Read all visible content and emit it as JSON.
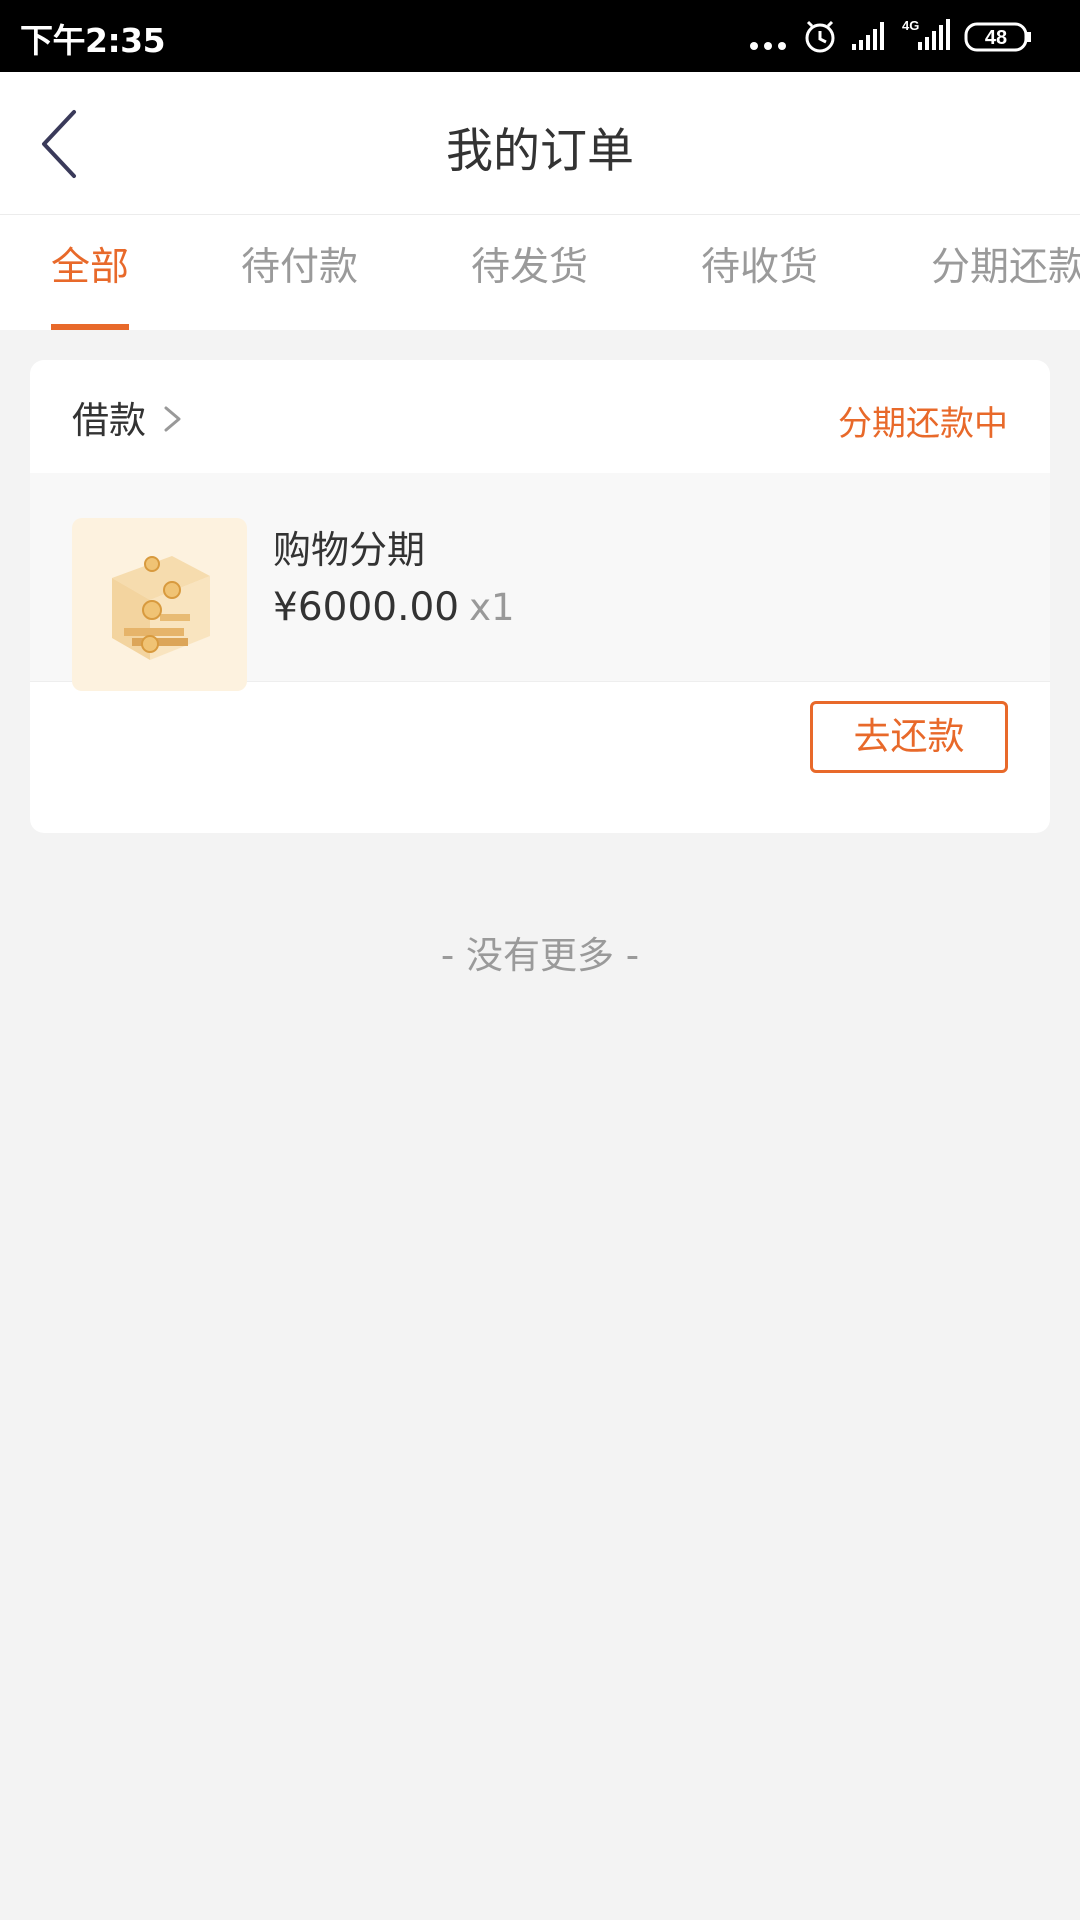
{
  "status_bar": {
    "time": "下午2:35",
    "network": "4G",
    "battery": "48",
    "icons": [
      "more-dots-icon",
      "alarm-icon",
      "signal-icon",
      "signal-4g-icon",
      "battery-icon"
    ]
  },
  "header": {
    "title": "我的订单",
    "back_icon": "chevron-left-icon"
  },
  "tabs": [
    {
      "label": "全部",
      "active": true
    },
    {
      "label": "待付款",
      "active": false
    },
    {
      "label": "待发货",
      "active": false
    },
    {
      "label": "待收货",
      "active": false
    },
    {
      "label": "分期还款",
      "active": false
    }
  ],
  "order": {
    "type": "借款",
    "status": "分期还款中",
    "item": {
      "name": "购物分期",
      "price": "¥6000.00",
      "quantity": "x1",
      "image_icon": "coin-cube-icon"
    },
    "action_label": "去还款"
  },
  "footer_text": "- 没有更多 -",
  "colors": {
    "accent": "#e8692a",
    "text": "#333333",
    "muted": "#9a9a9a",
    "background": "#f3f3f3"
  }
}
